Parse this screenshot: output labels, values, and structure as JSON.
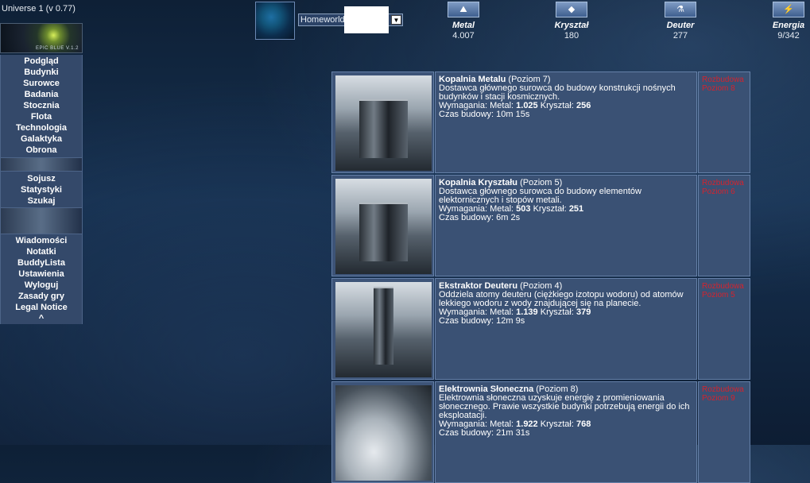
{
  "version": "Universe 1 (v 0.77)",
  "logo_text": "EPIC BLUE V.1.2",
  "menu": {
    "group1": [
      "Podgląd",
      "Budynki",
      "Surowce",
      "Badania",
      "Stocznia",
      "Flota",
      "Technologia",
      "Galaktyka",
      "Obrona"
    ],
    "group2": [
      "Sojusz",
      "Statystyki",
      "Szukaj"
    ],
    "group3": [
      "Wiadomości",
      "Notatki",
      "BuddyLista",
      "Ustawienia",
      "Wyloguj",
      "Zasady gry",
      "Legal Notice",
      "^"
    ]
  },
  "planet": {
    "name": "Homeworld",
    "dropdown_icon": "chevron-down-icon"
  },
  "resources": [
    {
      "name": "Metal",
      "value": "4.007",
      "icon": "metal-icon"
    },
    {
      "name": "Kryształ",
      "value": "180",
      "icon": "crystal-icon"
    },
    {
      "name": "Deuter",
      "value": "277",
      "icon": "deuterium-icon"
    },
    {
      "name": "Energia",
      "value": "9/342",
      "icon": "energy-icon"
    }
  ],
  "buildings": [
    {
      "name": "Kopalnia Metalu",
      "level": "(Poziom 7)",
      "description": "Dostawca głównego surowca do budowy konstrukcji nośnych budynków i stacji kosmicznych.",
      "req_label": "Wymagania:",
      "req_metal_label": "Metal:",
      "req_metal": "1.025",
      "req_crystal_label": "Kryształ:",
      "req_crystal": "256",
      "time_label": "Czas budowy:",
      "time": "10m 15s",
      "action": "Rozbudowa",
      "action_level": "Poziom 8"
    },
    {
      "name": "Kopalnia Kryształu",
      "level": "(Poziom 5)",
      "description": "Dostawca głównego surowca do budowy elementów elektornicznych i stopów metali.",
      "req_label": "Wymagania:",
      "req_metal_label": "Metal:",
      "req_metal": "503",
      "req_crystal_label": "Kryształ:",
      "req_crystal": "251",
      "time_label": "Czas budowy:",
      "time": "6m 2s",
      "action": "Rozbudowa",
      "action_level": "Poziom 6"
    },
    {
      "name": "Ekstraktor Deuteru",
      "level": "(Poziom 4)",
      "description": "Oddziela atomy deuteru (ciężkiego izotopu wodoru) od atomów lekkiego wodoru z wody znajdującej się na planecie.",
      "req_label": "Wymagania:",
      "req_metal_label": "Metal:",
      "req_metal": "1.139",
      "req_crystal_label": "Kryształ:",
      "req_crystal": "379",
      "time_label": "Czas budowy:",
      "time": "12m 9s",
      "action": "Rozbudowa",
      "action_level": "Poziom 5"
    },
    {
      "name": "Elektrownia Słoneczna",
      "level": "(Poziom 8)",
      "description": "Elektrownia słoneczna uzyskuje energię z promieniowania słonecznego. Prawie wszystkie budynki potrzebują energii do ich eksploatacji.",
      "req_label": "Wymagania:",
      "req_metal_label": "Metal:",
      "req_metal": "1.922",
      "req_crystal_label": "Kryształ:",
      "req_crystal": "768",
      "time_label": "Czas budowy:",
      "time": "21m 31s",
      "action": "Rozbudowa",
      "action_level": "Poziom 9"
    }
  ]
}
